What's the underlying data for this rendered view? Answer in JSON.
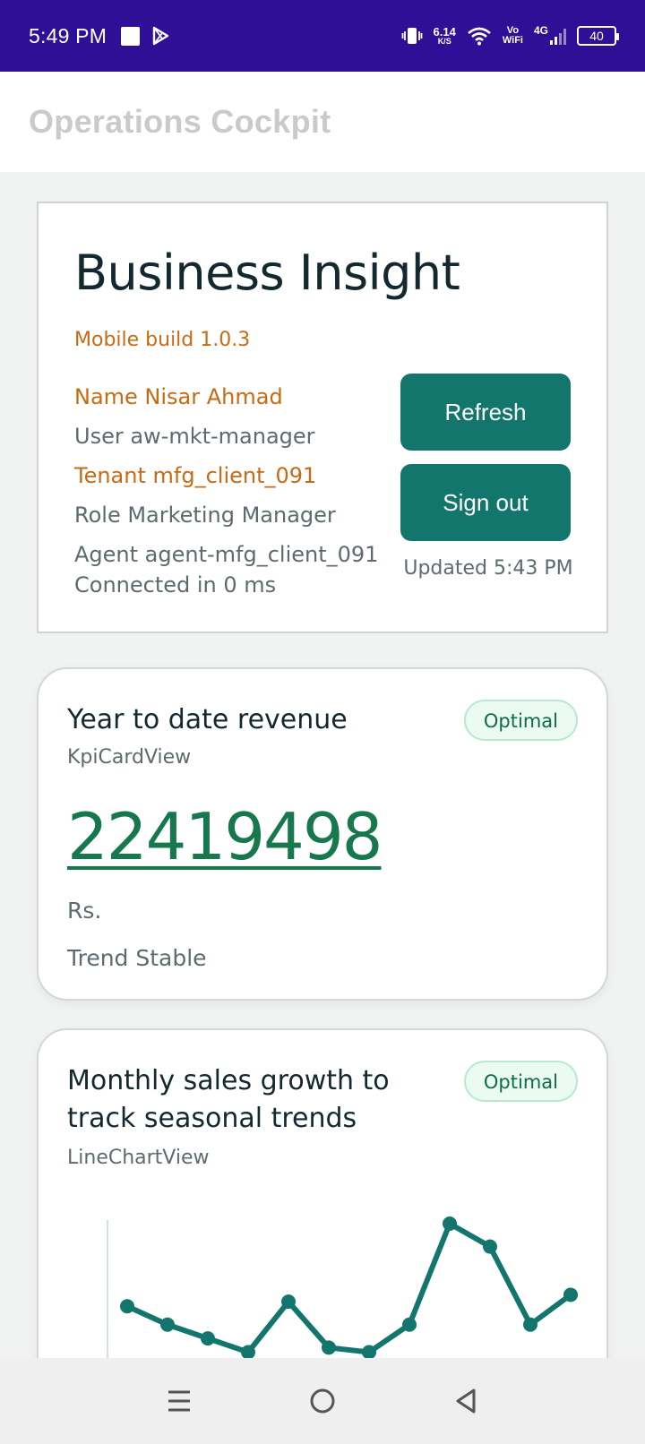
{
  "status_bar": {
    "time": "5:49 PM",
    "net_speed_value": "6.14",
    "net_speed_unit": "K/S",
    "vo_label": "Vo",
    "wifi_label": "WiFi",
    "network_type": "4G",
    "battery_level": "40",
    "icons": [
      "stop-square-icon",
      "play-store-icon",
      "vibrate-icon",
      "wifi-icon",
      "signal-icon",
      "battery-icon"
    ]
  },
  "header": {
    "title": "Operations Cockpit"
  },
  "profile": {
    "title": "Business Insight",
    "build": "Mobile build 1.0.3",
    "name": "Name Nisar Ahmad",
    "user": "User aw-mkt-manager",
    "tenant": "Tenant mfg_client_091",
    "role": "Role Marketing Manager",
    "agent": "Agent agent-mfg_client_091",
    "connected": "Connected in 0 ms",
    "refresh_label": "Refresh",
    "signout_label": "Sign out",
    "updated": "Updated 5:43 PM"
  },
  "kpi_card": {
    "title": "Year to date revenue",
    "view_type": "KpiCardView",
    "badge": "Optimal",
    "value": "22419498",
    "unit": "Rs.",
    "trend": "Trend Stable"
  },
  "chart_card": {
    "title": "Monthly sales growth to track seasonal trends",
    "view_type": "LineChartView",
    "badge": "Optimal"
  },
  "chart_data": {
    "type": "line",
    "title": "Monthly sales growth to track seasonal trends",
    "xlabel": "",
    "ylabel": "",
    "note": "visible portion only; lower part of chart scrolled out of view",
    "series": [
      {
        "values": [
          14,
          10,
          7,
          4,
          15,
          5,
          4,
          10,
          32,
          27,
          10,
          16.5
        ]
      }
    ],
    "ylim": [
      0,
      32
    ],
    "color": "#13766d"
  },
  "nav_bar": {
    "icons": [
      "menu-icon",
      "home-circle-icon",
      "back-triangle-icon"
    ]
  }
}
